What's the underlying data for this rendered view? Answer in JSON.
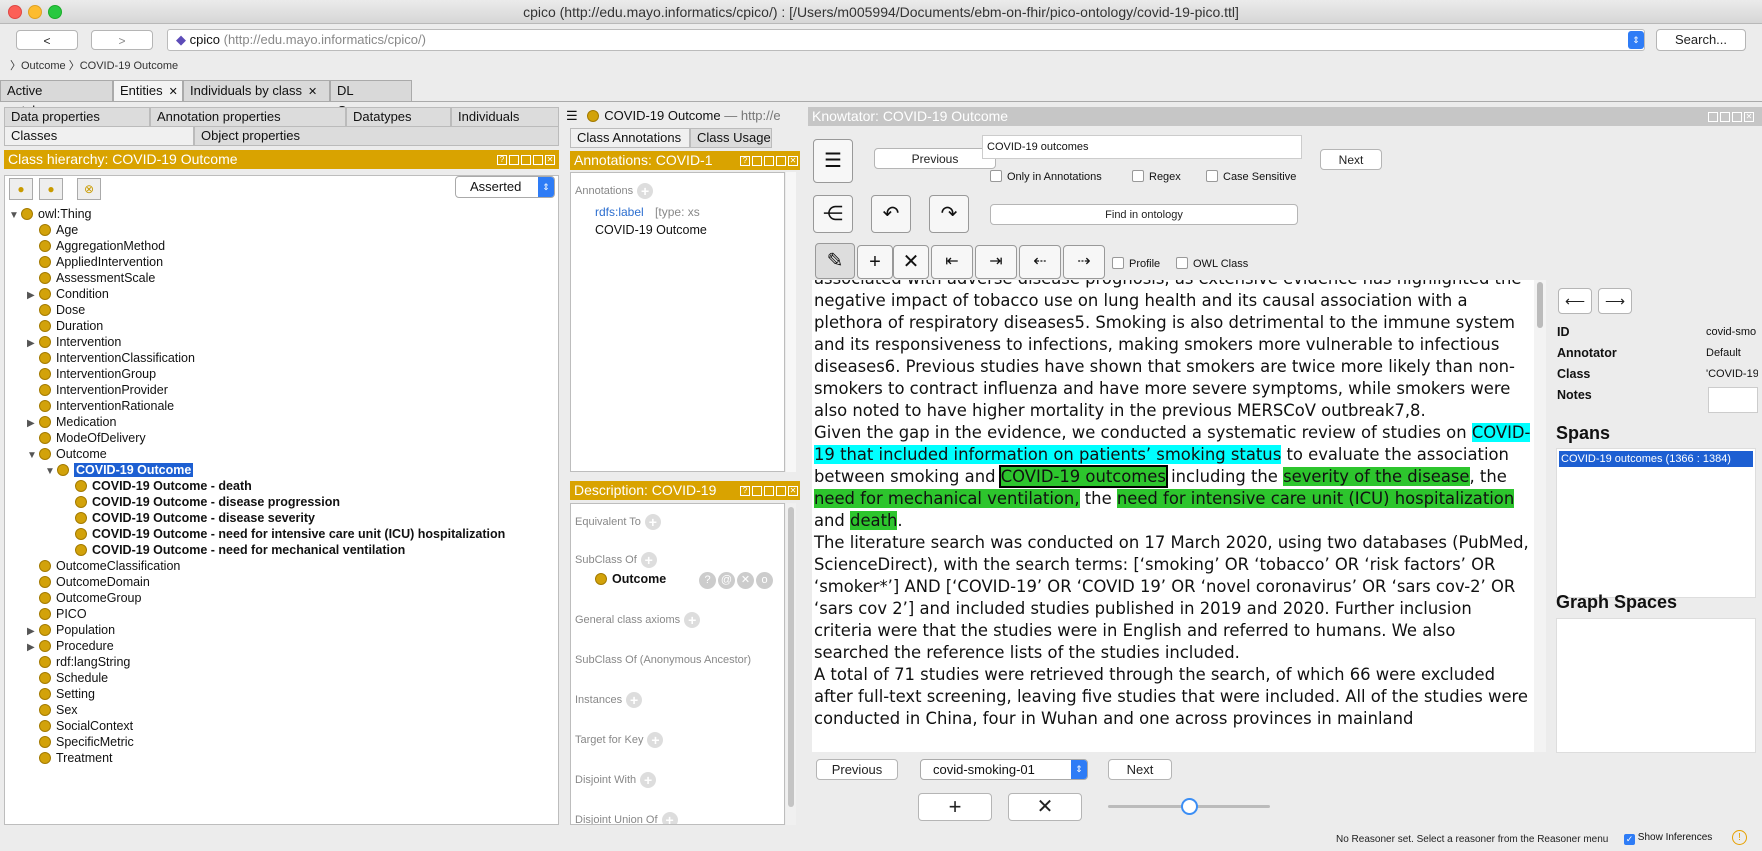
{
  "window": {
    "title": "cpico (http://edu.mayo.informatics/cpico/)  : [/Users/m005994/Documents/ebm-on-fhir/pico-ontology/covid-19-pico.ttl]"
  },
  "toolbar": {
    "back": "<",
    "forward": ">",
    "ontology_name": "cpico",
    "ontology_iri": "(http://edu.mayo.informatics/cpico/)",
    "search": "Search..."
  },
  "breadcrumb": {
    "items": [
      "Outcome",
      "COVID-19 Outcome"
    ]
  },
  "tabs": [
    {
      "label": "Active ontology"
    },
    {
      "label": "Entities"
    },
    {
      "label": "Individuals by class"
    },
    {
      "label": "DL Query"
    }
  ],
  "left": {
    "subtabs_row1": [
      "Data properties",
      "Annotation properties",
      "Datatypes",
      "Individuals"
    ],
    "subtabs_row2": [
      "Classes",
      "Object properties"
    ],
    "hierarchy_title": "Class hierarchy: COVID-19 Outcome",
    "mode": "Asserted",
    "tree": [
      {
        "label": "owl:Thing",
        "depth": 0,
        "exp": "down"
      },
      {
        "label": "Age",
        "depth": 1
      },
      {
        "label": "AggregationMethod",
        "depth": 1
      },
      {
        "label": "AppliedIntervention",
        "depth": 1
      },
      {
        "label": "AssessmentScale",
        "depth": 1
      },
      {
        "label": "Condition",
        "depth": 1,
        "exp": "right"
      },
      {
        "label": "Dose",
        "depth": 1
      },
      {
        "label": "Duration",
        "depth": 1
      },
      {
        "label": "Intervention",
        "depth": 1,
        "exp": "right"
      },
      {
        "label": "InterventionClassification",
        "depth": 1
      },
      {
        "label": "InterventionGroup",
        "depth": 1
      },
      {
        "label": "InterventionProvider",
        "depth": 1
      },
      {
        "label": "InterventionRationale",
        "depth": 1
      },
      {
        "label": "Medication",
        "depth": 1,
        "exp": "right"
      },
      {
        "label": "ModeOfDelivery",
        "depth": 1
      },
      {
        "label": "Outcome",
        "depth": 1,
        "exp": "down"
      },
      {
        "label": "COVID-19 Outcome",
        "depth": 2,
        "exp": "down",
        "bold": true,
        "selected": true
      },
      {
        "label": "COVID-19 Outcome - death",
        "depth": 3,
        "bold": true
      },
      {
        "label": "COVID-19 Outcome - disease progression",
        "depth": 3,
        "bold": true
      },
      {
        "label": "COVID-19 Outcome - disease severity",
        "depth": 3,
        "bold": true
      },
      {
        "label": "COVID-19 Outcome - need for intensive care unit (ICU) hospitalization",
        "depth": 3,
        "bold": true
      },
      {
        "label": "COVID-19 Outcome - need for mechanical ventilation",
        "depth": 3,
        "bold": true
      },
      {
        "label": "OutcomeClassification",
        "depth": 1
      },
      {
        "label": "OutcomeDomain",
        "depth": 1
      },
      {
        "label": "OutcomeGroup",
        "depth": 1
      },
      {
        "label": "PICO",
        "depth": 1
      },
      {
        "label": "Population",
        "depth": 1,
        "exp": "right"
      },
      {
        "label": "Procedure",
        "depth": 1,
        "exp": "right"
      },
      {
        "label": "rdf:langString",
        "depth": 1
      },
      {
        "label": "Schedule",
        "depth": 1
      },
      {
        "label": "Setting",
        "depth": 1
      },
      {
        "label": "Sex",
        "depth": 1
      },
      {
        "label": "SocialContext",
        "depth": 1
      },
      {
        "label": "SpecificMetric",
        "depth": 1
      },
      {
        "label": "Treatment",
        "depth": 1
      }
    ]
  },
  "middle": {
    "header_name": "COVID-19 Outcome",
    "header_iri": "— http://e",
    "tabs": [
      "Class Annotations",
      "Class Usage"
    ],
    "annotations_title": "Annotations: COVID-1",
    "annotations_label": "Annotations",
    "rdfs_label": "rdfs:label",
    "type_hint": "[type: xs",
    "annotation_value": "COVID-19 Outcome",
    "description_title": "Description: COVID-19",
    "sections": [
      "Equivalent To",
      "SubClass Of",
      "General class axioms",
      "SubClass Of (Anonymous Ancestor)",
      "Instances",
      "Target for Key",
      "Disjoint With",
      "Disjoint Union Of"
    ],
    "subclass_value": "Outcome"
  },
  "knowtator": {
    "title": "Knowtator: COVID-19 Outcome",
    "previous": "Previous",
    "next": "Next",
    "search_value": "COVID-19 outcomes",
    "opt_only_annotations": "Only in Annotations",
    "opt_regex": "Regex",
    "opt_case": "Case Sensitive",
    "find_in_ontology": "Find in ontology",
    "opt_profile": "Profile",
    "opt_owl_class": "OWL Class",
    "doc_select": "covid-smoking-01",
    "bottom_previous": "Previous",
    "bottom_next": "Next",
    "slider": 0.5,
    "text_parts": [
      {
        "t": "associated with adverse disease prognosis, as extensive evidence has highlighted the negative impact of tobacco use on lung health and its causal association with a plethora of respiratory diseases5. Smoking is also detrimental to the immune system and its responsiveness to infections, making smokers more vulnerable to infectious diseases6. Previous studies have shown that smokers are twice more likely than non-smokers to contract influenza and have more severe symptoms, while smokers were also noted to have higher mortality in the previous MERSCoV outbreak7,8.\nGiven the gap in the evidence, we conducted a systematic review of studies on ",
        "h": ""
      },
      {
        "t": "COVID-19 that included information on patients’ smoking status",
        "h": "cyan"
      },
      {
        "t": " to evaluate the association between smoking and ",
        "h": ""
      },
      {
        "t": "COVID-19 outcomes",
        "h": "box"
      },
      {
        "t": " including the ",
        "h": ""
      },
      {
        "t": "severity of the disease",
        "h": "green"
      },
      {
        "t": ", the ",
        "h": ""
      },
      {
        "t": "need for mechanical ventilation,",
        "h": "green"
      },
      {
        "t": " the ",
        "h": ""
      },
      {
        "t": "need for intensive care unit (ICU) hospitalization",
        "h": "green"
      },
      {
        "t": " and ",
        "h": ""
      },
      {
        "t": "death",
        "h": "green"
      },
      {
        "t": ".\nThe literature search was conducted on 17 March 2020, using two databases (PubMed, ScienceDirect), with the search terms: [‘smoking’ OR ‘tobacco’ OR ‘risk factors’ OR ‘smoker*’] AND [‘COVID-19’ OR ‘COVID 19’ OR ‘novel coronavirus’ OR ‘sars cov-2’ OR ‘sars cov 2’] and included studies published in 2019 and 2020. Further inclusion criteria were that the studies were in English and referred to humans. We also searched the reference lists of the studies included.\nA total of 71 studies were retrieved through the search, of which 66 were excluded after full-text screening, leaving five studies that were included. All of the studies were conducted in China, four in Wuhan and one across provinces in mainland",
        "h": ""
      }
    ],
    "side": {
      "id_label": "ID",
      "id_value": "covid-smo",
      "annotator_label": "Annotator",
      "annotator_value": "Default",
      "class_label": "Class",
      "class_value": "'COVID-19",
      "notes_label": "Notes",
      "spans_title": "Spans",
      "span_item": "COVID-19 outcomes  (1366 : 1384)",
      "graph_title": "Graph Spaces"
    }
  },
  "status": {
    "reasoner": "No Reasoner set. Select a reasoner from the Reasoner menu",
    "show_inferences": "Show Inferences"
  }
}
